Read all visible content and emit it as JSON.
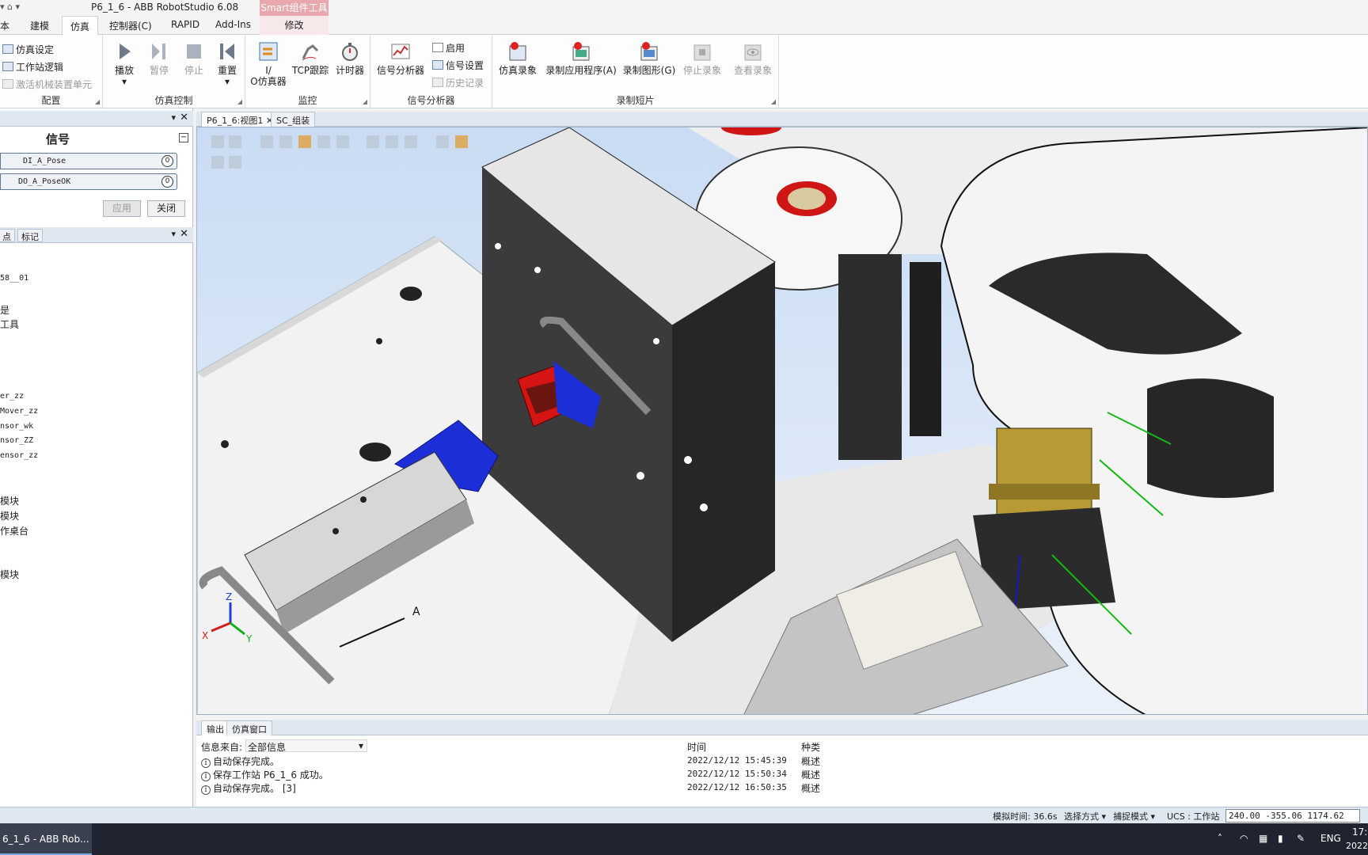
{
  "window": {
    "title": "P6_1_6 - ABB RobotStudio 6.08"
  },
  "context_tab": {
    "group": "Smart组件工具",
    "tab": "修改"
  },
  "tabs": [
    {
      "label": "本"
    },
    {
      "label": "建模"
    },
    {
      "label": "仿真"
    },
    {
      "label": "控制器(C)"
    },
    {
      "label": "RAPID"
    },
    {
      "label": "Add-Ins"
    }
  ],
  "ribbon": {
    "config": {
      "label": "配置",
      "items": [
        "仿真设定",
        "工作站逻辑",
        "激活机械装置单元"
      ]
    },
    "sim_control": {
      "label": "仿真控制",
      "play": "播放",
      "pause": "暂停",
      "stop": "停止",
      "reset": "重置"
    },
    "monitor": {
      "label": "监控",
      "io_sim_1": "I/",
      "io_sim_2": "O仿真器",
      "tcp_trace": "TCP跟踪",
      "timer": "计时器"
    },
    "signal_analyzer": {
      "label": "信号分析器",
      "analyzer": "信号分析器",
      "enable": "启用",
      "settings": "信号设置",
      "history": "历史记录"
    },
    "record": {
      "label": "录制短片",
      "sim_record": "仿真录象",
      "record_app": "录制应用程序(A)",
      "record_graphics": "录制图形(G)",
      "stop_record": "停止录象",
      "view_record": "查看录象"
    }
  },
  "signal_panel": {
    "title": "信号",
    "signals": [
      {
        "name": "DI_A_Pose",
        "value": "0"
      },
      {
        "name": "DO_A_PoseOK",
        "value": "0"
      }
    ],
    "apply": "应用",
    "close": "关闭"
  },
  "tree_panel": {
    "tabs": [
      "点",
      "标记"
    ],
    "items": [
      "58__01",
      "是",
      "工具",
      "er_zz",
      "Mover_zz",
      "nsor_wk",
      "nsor_ZZ",
      "ensor_zz",
      "模块",
      "模块",
      "作桌台",
      "模块"
    ]
  },
  "doc_tabs": [
    {
      "label": "P6_1_6:视图1"
    },
    {
      "label": "SC_组装"
    }
  ],
  "viewport": {
    "marker_a": "A",
    "axis_x": "X",
    "axis_y": "Y",
    "axis_z": "Z"
  },
  "output": {
    "tabs": [
      "输出",
      "仿真窗口"
    ],
    "source_label": "信息来自:",
    "source_value": "全部信息",
    "col_time": "时间",
    "col_type": "种类",
    "rows": [
      {
        "msg": "自动保存完成。",
        "time": "2022/12/12 15:45:39",
        "type": "概述"
      },
      {
        "msg": "保存工作站 P6_1_6 成功。",
        "time": "2022/12/12 15:50:34",
        "type": "概述"
      },
      {
        "msg": "自动保存完成。 [3]",
        "time": "2022/12/12 16:50:35",
        "type": "概述"
      }
    ]
  },
  "status": {
    "sim_time": "模拟时间: 36.6s",
    "select_mode": "选择方式",
    "snap_mode": "捕捉模式",
    "ucs": "UCS : 工作站",
    "coords": "240.00   -355.06   1174.62"
  },
  "taskbar": {
    "app": "6_1_6 - ABB Rob...",
    "lang": "ENG",
    "clock1": "17:",
    "clock2": "2022"
  },
  "colors": {
    "ribbon_bg": "#fdfdfd",
    "panel_header": "#dfe7f1",
    "context_tab": "#e8a8ae",
    "viewport_sky": "#c9dcf3"
  }
}
